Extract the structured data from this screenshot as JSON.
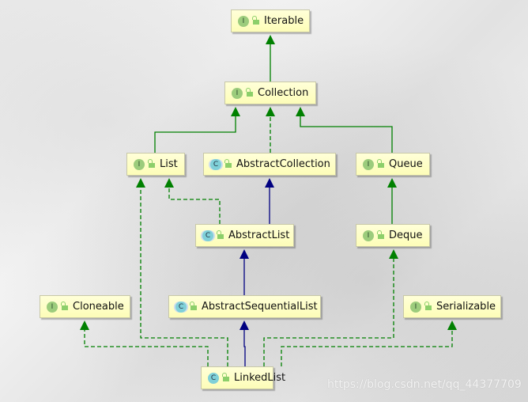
{
  "diagram": {
    "nodes": {
      "iterable": {
        "label": "Iterable",
        "kind": "interface",
        "kind_letter": "I"
      },
      "collection": {
        "label": "Collection",
        "kind": "interface",
        "kind_letter": "I"
      },
      "list": {
        "label": "List",
        "kind": "interface",
        "kind_letter": "I"
      },
      "abstract_collection": {
        "label": "AbstractCollection",
        "kind": "abstract-class",
        "kind_letter": "C"
      },
      "queue": {
        "label": "Queue",
        "kind": "interface",
        "kind_letter": "I"
      },
      "abstract_list": {
        "label": "AbstractList",
        "kind": "abstract-class",
        "kind_letter": "C"
      },
      "deque": {
        "label": "Deque",
        "kind": "interface",
        "kind_letter": "I"
      },
      "cloneable": {
        "label": "Cloneable",
        "kind": "interface",
        "kind_letter": "I"
      },
      "abstract_sequential_list": {
        "label": "AbstractSequentialList",
        "kind": "abstract-class",
        "kind_letter": "C"
      },
      "serializable": {
        "label": "Serializable",
        "kind": "interface",
        "kind_letter": "I"
      },
      "linked_list": {
        "label": "LinkedList",
        "kind": "class",
        "kind_letter": "C"
      }
    },
    "edges": [
      {
        "from": "Collection",
        "to": "Iterable",
        "type": "extends-interface"
      },
      {
        "from": "List",
        "to": "Collection",
        "type": "extends-interface"
      },
      {
        "from": "AbstractCollection",
        "to": "Collection",
        "type": "implements"
      },
      {
        "from": "Queue",
        "to": "Collection",
        "type": "extends-interface"
      },
      {
        "from": "Deque",
        "to": "Queue",
        "type": "extends-interface"
      },
      {
        "from": "AbstractList",
        "to": "AbstractCollection",
        "type": "extends-class"
      },
      {
        "from": "AbstractList",
        "to": "List",
        "type": "implements"
      },
      {
        "from": "AbstractSequentialList",
        "to": "AbstractList",
        "type": "extends-class"
      },
      {
        "from": "LinkedList",
        "to": "AbstractSequentialList",
        "type": "extends-class"
      },
      {
        "from": "LinkedList",
        "to": "List",
        "type": "implements"
      },
      {
        "from": "LinkedList",
        "to": "Cloneable",
        "type": "implements"
      },
      {
        "from": "LinkedList",
        "to": "Deque",
        "type": "implements"
      },
      {
        "from": "LinkedList",
        "to": "Serializable",
        "type": "implements"
      }
    ],
    "colors": {
      "interface_edge": "#008000",
      "class_edge": "#000080",
      "node_fill": "#fdfdc0"
    }
  },
  "watermark": "https://blog.csdn.net/qq_44377709"
}
